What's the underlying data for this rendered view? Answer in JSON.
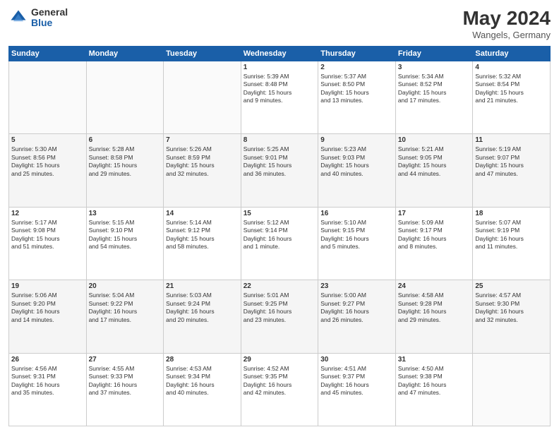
{
  "header": {
    "logo_general": "General",
    "logo_blue": "Blue",
    "month_title": "May 2024",
    "location": "Wangels, Germany"
  },
  "weekdays": [
    "Sunday",
    "Monday",
    "Tuesday",
    "Wednesday",
    "Thursday",
    "Friday",
    "Saturday"
  ],
  "weeks": [
    [
      {
        "day": "",
        "info": ""
      },
      {
        "day": "",
        "info": ""
      },
      {
        "day": "",
        "info": ""
      },
      {
        "day": "1",
        "info": "Sunrise: 5:39 AM\nSunset: 8:48 PM\nDaylight: 15 hours\nand 9 minutes."
      },
      {
        "day": "2",
        "info": "Sunrise: 5:37 AM\nSunset: 8:50 PM\nDaylight: 15 hours\nand 13 minutes."
      },
      {
        "day": "3",
        "info": "Sunrise: 5:34 AM\nSunset: 8:52 PM\nDaylight: 15 hours\nand 17 minutes."
      },
      {
        "day": "4",
        "info": "Sunrise: 5:32 AM\nSunset: 8:54 PM\nDaylight: 15 hours\nand 21 minutes."
      }
    ],
    [
      {
        "day": "5",
        "info": "Sunrise: 5:30 AM\nSunset: 8:56 PM\nDaylight: 15 hours\nand 25 minutes."
      },
      {
        "day": "6",
        "info": "Sunrise: 5:28 AM\nSunset: 8:58 PM\nDaylight: 15 hours\nand 29 minutes."
      },
      {
        "day": "7",
        "info": "Sunrise: 5:26 AM\nSunset: 8:59 PM\nDaylight: 15 hours\nand 32 minutes."
      },
      {
        "day": "8",
        "info": "Sunrise: 5:25 AM\nSunset: 9:01 PM\nDaylight: 15 hours\nand 36 minutes."
      },
      {
        "day": "9",
        "info": "Sunrise: 5:23 AM\nSunset: 9:03 PM\nDaylight: 15 hours\nand 40 minutes."
      },
      {
        "day": "10",
        "info": "Sunrise: 5:21 AM\nSunset: 9:05 PM\nDaylight: 15 hours\nand 44 minutes."
      },
      {
        "day": "11",
        "info": "Sunrise: 5:19 AM\nSunset: 9:07 PM\nDaylight: 15 hours\nand 47 minutes."
      }
    ],
    [
      {
        "day": "12",
        "info": "Sunrise: 5:17 AM\nSunset: 9:08 PM\nDaylight: 15 hours\nand 51 minutes."
      },
      {
        "day": "13",
        "info": "Sunrise: 5:15 AM\nSunset: 9:10 PM\nDaylight: 15 hours\nand 54 minutes."
      },
      {
        "day": "14",
        "info": "Sunrise: 5:14 AM\nSunset: 9:12 PM\nDaylight: 15 hours\nand 58 minutes."
      },
      {
        "day": "15",
        "info": "Sunrise: 5:12 AM\nSunset: 9:14 PM\nDaylight: 16 hours\nand 1 minute."
      },
      {
        "day": "16",
        "info": "Sunrise: 5:10 AM\nSunset: 9:15 PM\nDaylight: 16 hours\nand 5 minutes."
      },
      {
        "day": "17",
        "info": "Sunrise: 5:09 AM\nSunset: 9:17 PM\nDaylight: 16 hours\nand 8 minutes."
      },
      {
        "day": "18",
        "info": "Sunrise: 5:07 AM\nSunset: 9:19 PM\nDaylight: 16 hours\nand 11 minutes."
      }
    ],
    [
      {
        "day": "19",
        "info": "Sunrise: 5:06 AM\nSunset: 9:20 PM\nDaylight: 16 hours\nand 14 minutes."
      },
      {
        "day": "20",
        "info": "Sunrise: 5:04 AM\nSunset: 9:22 PM\nDaylight: 16 hours\nand 17 minutes."
      },
      {
        "day": "21",
        "info": "Sunrise: 5:03 AM\nSunset: 9:24 PM\nDaylight: 16 hours\nand 20 minutes."
      },
      {
        "day": "22",
        "info": "Sunrise: 5:01 AM\nSunset: 9:25 PM\nDaylight: 16 hours\nand 23 minutes."
      },
      {
        "day": "23",
        "info": "Sunrise: 5:00 AM\nSunset: 9:27 PM\nDaylight: 16 hours\nand 26 minutes."
      },
      {
        "day": "24",
        "info": "Sunrise: 4:58 AM\nSunset: 9:28 PM\nDaylight: 16 hours\nand 29 minutes."
      },
      {
        "day": "25",
        "info": "Sunrise: 4:57 AM\nSunset: 9:30 PM\nDaylight: 16 hours\nand 32 minutes."
      }
    ],
    [
      {
        "day": "26",
        "info": "Sunrise: 4:56 AM\nSunset: 9:31 PM\nDaylight: 16 hours\nand 35 minutes."
      },
      {
        "day": "27",
        "info": "Sunrise: 4:55 AM\nSunset: 9:33 PM\nDaylight: 16 hours\nand 37 minutes."
      },
      {
        "day": "28",
        "info": "Sunrise: 4:53 AM\nSunset: 9:34 PM\nDaylight: 16 hours\nand 40 minutes."
      },
      {
        "day": "29",
        "info": "Sunrise: 4:52 AM\nSunset: 9:35 PM\nDaylight: 16 hours\nand 42 minutes."
      },
      {
        "day": "30",
        "info": "Sunrise: 4:51 AM\nSunset: 9:37 PM\nDaylight: 16 hours\nand 45 minutes."
      },
      {
        "day": "31",
        "info": "Sunrise: 4:50 AM\nSunset: 9:38 PM\nDaylight: 16 hours\nand 47 minutes."
      },
      {
        "day": "",
        "info": ""
      }
    ]
  ]
}
